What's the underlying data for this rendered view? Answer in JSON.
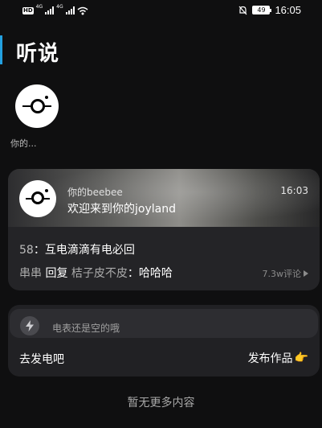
{
  "status_bar": {
    "hd_label": "HD",
    "net_label_1": "4G",
    "net_label_2": "4G",
    "battery_level": "49",
    "time": "16:05"
  },
  "header": {
    "title": "听说"
  },
  "profile": {
    "caption": "你的..."
  },
  "post_card": {
    "author": "你的beebee",
    "welcome": "欢迎来到你的joyland",
    "time": "16:03",
    "post_number": "58",
    "post_text": "：互电滴滴有电必回",
    "commenter": "串串",
    "reply_word": "回复",
    "reply_target": "桔子皮不皮",
    "comment_text": "：哈哈哈",
    "comment_count": "7.3w评论"
  },
  "energy_card": {
    "status_text": "电表还是空的哦",
    "charge_label": "去发电吧",
    "publish_label": "发布作品",
    "publish_emoji": "👉"
  },
  "footer": {
    "no_more_text": "暂无更多内容"
  },
  "colors": {
    "background": "#0f0f10",
    "card": "#242427",
    "accent_edge": "#23a0e0"
  }
}
